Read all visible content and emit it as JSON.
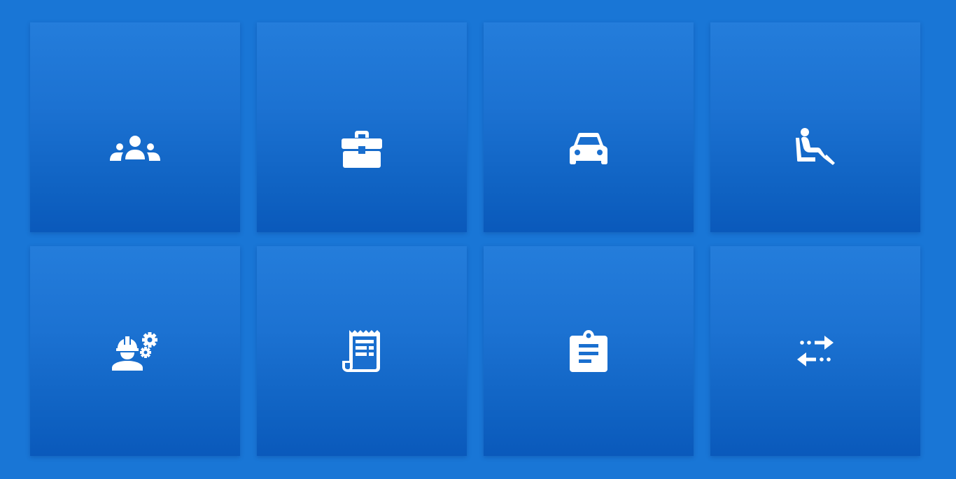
{
  "colors": {
    "background": "#1976d6",
    "tile_top": "#247ddb",
    "tile_bottom": "#0a59bb",
    "icon": "#ffffff"
  },
  "tiles": [
    {
      "icon": "people-group-icon"
    },
    {
      "icon": "briefcase-icon"
    },
    {
      "icon": "car-icon"
    },
    {
      "icon": "seated-person-icon"
    },
    {
      "icon": "engineer-settings-icon"
    },
    {
      "icon": "receipt-icon"
    },
    {
      "icon": "clipboard-icon"
    },
    {
      "icon": "transfer-arrows-icon"
    }
  ]
}
